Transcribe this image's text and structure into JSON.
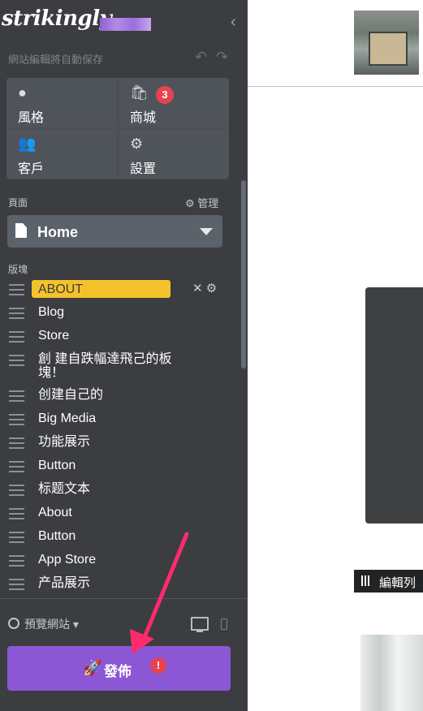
{
  "brand": {
    "logo_text": "strikingly",
    "accent_color": "#8c57d5"
  },
  "sidebar": {
    "collapse_icon": "chevron-left-icon",
    "autosave_text": "網站編輯將自動保存",
    "nav_grid": [
      {
        "label": "風格",
        "icon": "palette-icon"
      },
      {
        "label": "商城",
        "icon": "shopping-bag-icon",
        "badge": "3"
      },
      {
        "label": "客戶",
        "icon": "users-icon"
      },
      {
        "label": "設置",
        "icon": "gear-icon"
      }
    ],
    "pages_label": "頁面",
    "manage_label": "管理",
    "current_page": "Home",
    "sections_label": "版塊",
    "sections": [
      {
        "name": "ABOUT",
        "active": true
      },
      {
        "name": "Blog"
      },
      {
        "name": "Store"
      },
      {
        "name": "創 建自跌幅達飛己的板 塊！"
      },
      {
        "name": "创建自己的"
      },
      {
        "name": "Big Media"
      },
      {
        "name": "功能展示"
      },
      {
        "name": "Button"
      },
      {
        "name": "标题文本"
      },
      {
        "name": "About"
      },
      {
        "name": "Button"
      },
      {
        "name": "App Store"
      },
      {
        "name": "产品展示"
      }
    ],
    "preview_label": "預覽網站",
    "publish_label": "發佈"
  },
  "canvas": {
    "edit_bar_label": "編輯列"
  },
  "colors": {
    "sidebar_bg": "#3b3d40",
    "active_section": "#f4c22b",
    "badge_red": "#e84150"
  }
}
